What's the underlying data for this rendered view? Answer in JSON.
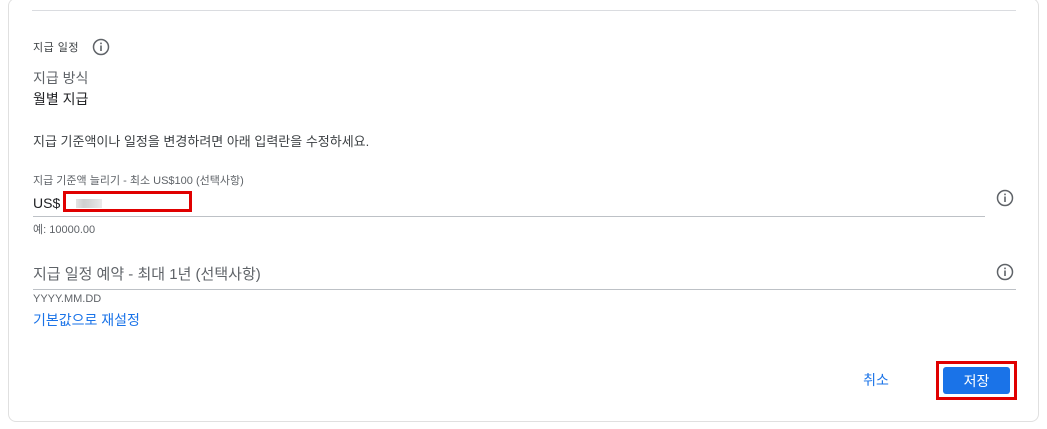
{
  "payment_schedule": {
    "header": "지급 일정",
    "header_icon": "info-icon",
    "method_label": "지급 방식",
    "method_value": "월별 지급",
    "instructions": "지급 기준액이나 일정을 변경하려면 아래 입력란을 수정하세요."
  },
  "threshold": {
    "label": "지급 기준액 늘리기 - 최소 US$100 (선택사항)",
    "prefix": "US$",
    "value": "",
    "hint": "예: 10000.00",
    "info_icon": "info-icon"
  },
  "schedule": {
    "placeholder": "지급 일정 예약 - 최대 1년 (선택사항)",
    "date_format_hint": "YYYY.MM.DD",
    "reset_link": "기본값으로 재설정",
    "info_icon": "info-icon"
  },
  "actions": {
    "cancel_label": "취소",
    "save_label": "저장"
  },
  "colors": {
    "accent": "#1a73e8",
    "highlight": "#e00000"
  }
}
